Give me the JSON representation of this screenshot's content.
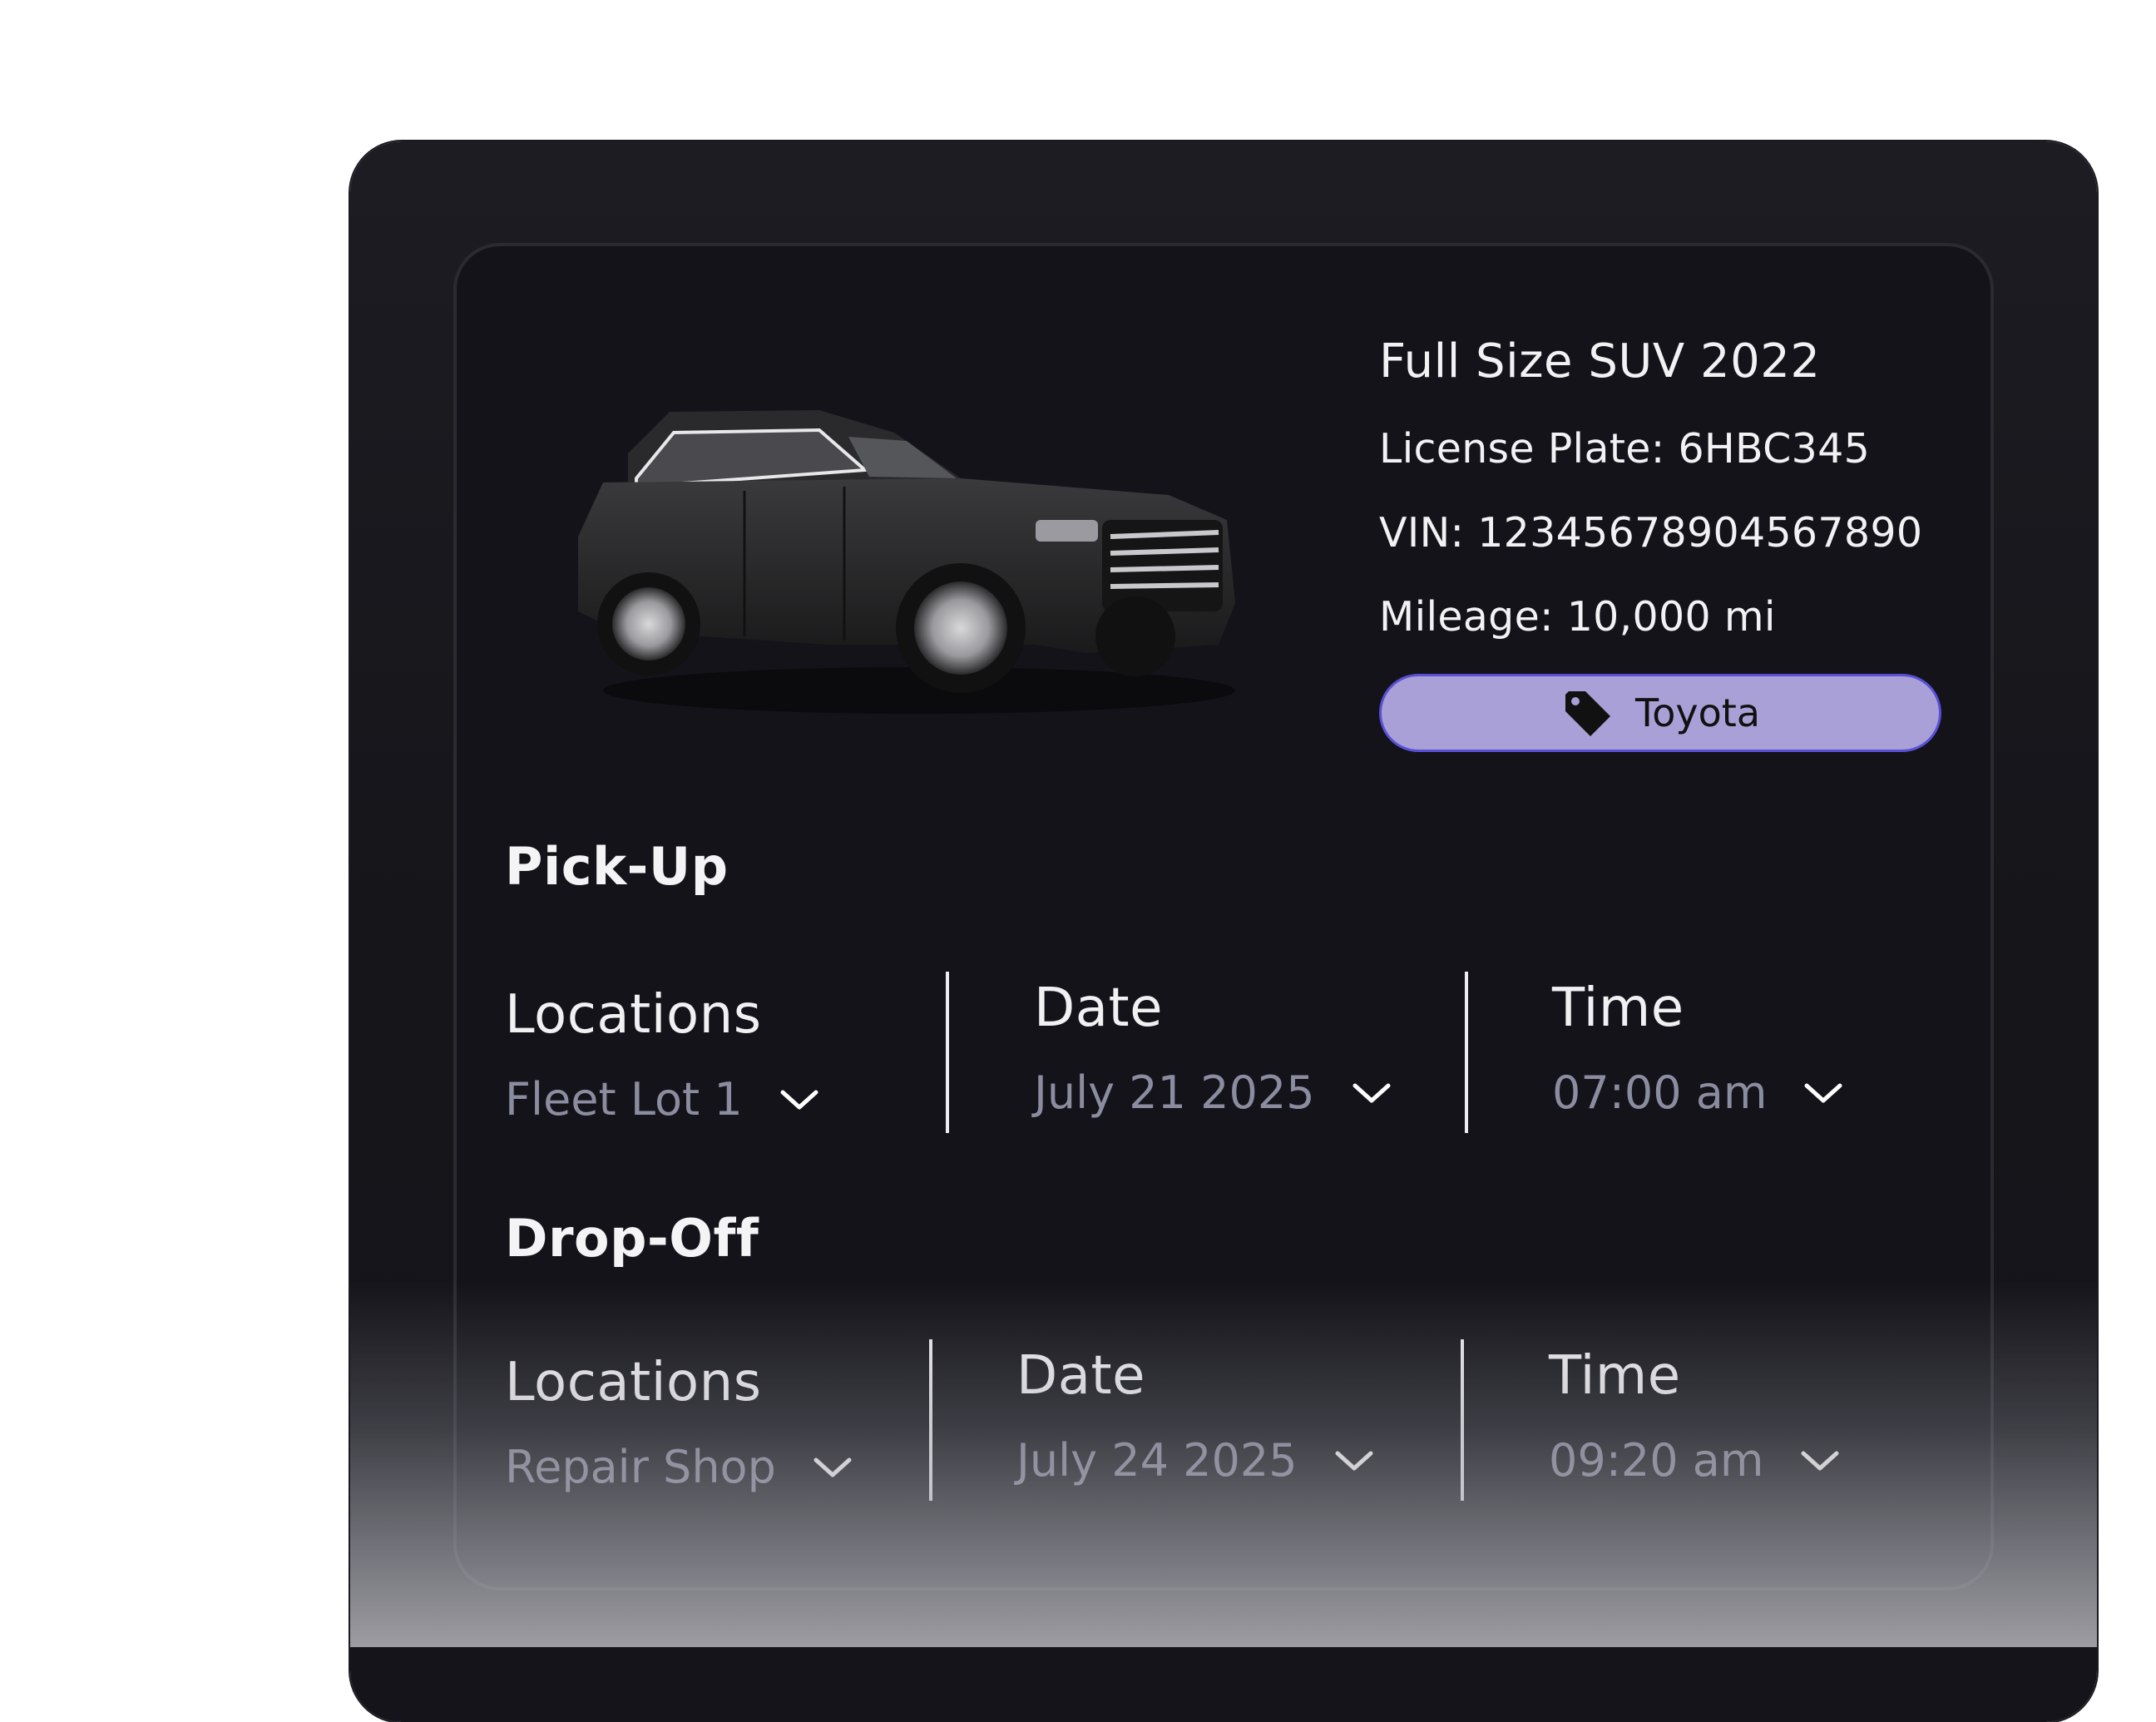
{
  "vehicle": {
    "title": "Full Size SUV 2022",
    "license_plate": "License Plate: 6HBC345",
    "vin": "VIN: 12345678904567890",
    "mileage": "Mileage: 10,000 mi",
    "brand": "Toyota",
    "brand_icon": "tag-icon"
  },
  "pickup": {
    "section_title": "Pick-Up",
    "location_label": "Locations",
    "location_value": "Fleet Lot 1",
    "date_label": "Date",
    "date_value": "July 21 2025",
    "time_label": "Time",
    "time_value": "07:00 am"
  },
  "dropoff": {
    "section_title": "Drop-Off",
    "location_label": "Locations",
    "location_value": "Repair Shop",
    "date_label": "Date",
    "date_value": "July 24 2025",
    "time_label": "Time",
    "time_value": "09:20 am"
  },
  "colors": {
    "panel_bg": "#1c1c22",
    "card_bg": "#131319",
    "brand_pill_bg": "#a8a0d6",
    "brand_pill_border": "#5a4fd6",
    "muted_value": "#8c8ca0"
  }
}
